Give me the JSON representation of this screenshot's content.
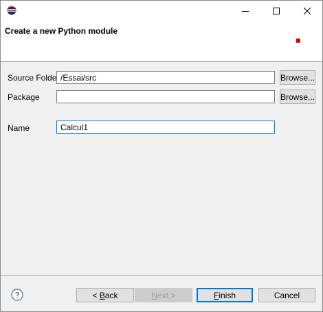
{
  "titlebar": {
    "minimize": "minimize-icon",
    "maximize": "maximize-icon",
    "close": "close-icon"
  },
  "header": {
    "title": "Create a new Python module"
  },
  "form": {
    "source_folder_label": "Source Folder",
    "source_folder_value": "/Essai/src",
    "package_label": "Package",
    "package_value": "",
    "name_label": "Name",
    "name_value": "Calcul1",
    "browse_label": "Browse..."
  },
  "buttons": {
    "back_prefix": "< ",
    "back_mnemonic": "B",
    "back_rest": "ack",
    "next_mnemonic": "N",
    "next_rest": "ext >",
    "finish_mnemonic": "F",
    "finish_rest": "inish",
    "cancel": "Cancel"
  },
  "colors": {
    "accent": "#0078d7",
    "header_mark": "#e00000"
  }
}
